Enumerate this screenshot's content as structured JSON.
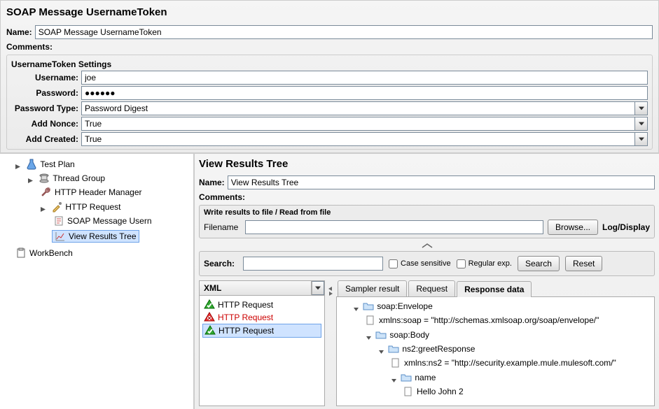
{
  "top": {
    "title": "SOAP Message UsernameToken",
    "name_label": "Name:",
    "name_value": "SOAP Message UsernameToken",
    "comments_label": "Comments:"
  },
  "settings": {
    "legend": "UsernameToken Settings",
    "username_label": "Username:",
    "username_value": "joe",
    "password_label": "Password:",
    "password_value": "●●●●●●",
    "password_type_label": "Password Type:",
    "password_type_value": "Password Digest",
    "add_nonce_label": "Add Nonce:",
    "add_nonce_value": "True",
    "add_created_label": "Add Created:",
    "add_created_value": "True"
  },
  "tree": {
    "test_plan": "Test Plan",
    "thread_group": "Thread Group",
    "http_header_mgr": "HTTP Header Manager",
    "http_request": "HTTP Request",
    "soap_msg_user": "SOAP Message Usern",
    "view_results_tree": "View Results Tree",
    "workbench": "WorkBench"
  },
  "right": {
    "title": "View Results Tree",
    "name_label": "Name:",
    "name_value": "View Results Tree",
    "comments_label": "Comments:",
    "file_panel_title": "Write results to file / Read from file",
    "filename_label": "Filename",
    "browse_btn": "Browse...",
    "logdisplay": "Log/Display",
    "search_label": "Search:",
    "case_sensitive": "Case sensitive",
    "regular_exp": "Regular exp.",
    "search_btn": "Search",
    "reset_btn": "Reset",
    "view_format": "XML",
    "tabs": {
      "sampler": "Sampler result",
      "request": "Request",
      "response": "Response data"
    },
    "results": [
      {
        "label": "HTTP Request",
        "status": "pass"
      },
      {
        "label": "HTTP Request",
        "status": "fail"
      },
      {
        "label": "HTTP Request",
        "status": "pass",
        "selected": true
      }
    ],
    "xml": {
      "envelope": "soap:Envelope",
      "xmlns_soap": "xmlns:soap = \"http://schemas.xmlsoap.org/soap/envelope/\"",
      "body": "soap:Body",
      "greet": "ns2:greetResponse",
      "xmlns_ns2": "xmlns:ns2 = \"http://security.example.mule.mulesoft.com/\"",
      "name_node": "name",
      "hello": "Hello John 2"
    }
  }
}
